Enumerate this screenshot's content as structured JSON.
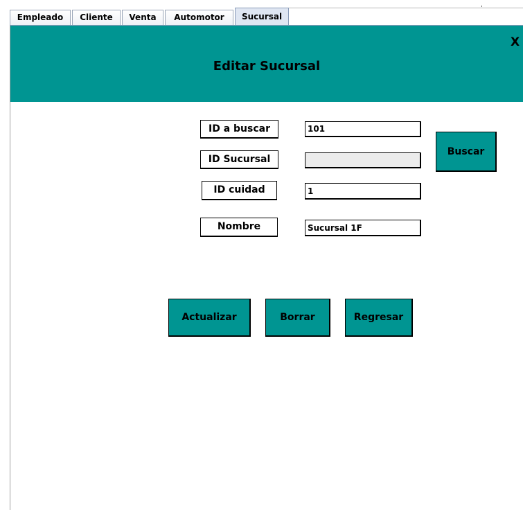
{
  "tabs": [
    {
      "label": "Empleado"
    },
    {
      "label": "Cliente"
    },
    {
      "label": "Venta"
    },
    {
      "label": "Automotor"
    },
    {
      "label": "Sucursal",
      "active": true
    }
  ],
  "header": {
    "title": "Editar Sucursal",
    "close_label": "X"
  },
  "form": {
    "id_buscar_label": "ID a buscar",
    "id_buscar_value": "101",
    "id_sucursal_label": "ID Sucursal",
    "id_sucursal_value": "",
    "id_ciudad_label": "ID cuidad",
    "id_ciudad_value": "1",
    "nombre_label": "Nombre",
    "nombre_value": "Sucursal 1F"
  },
  "buttons": {
    "buscar": "Buscar",
    "actualizar": "Actualizar",
    "borrar": "Borrar",
    "regresar": "Regresar"
  },
  "colors": {
    "accent": "#009592",
    "disabled_field": "#ececec"
  }
}
